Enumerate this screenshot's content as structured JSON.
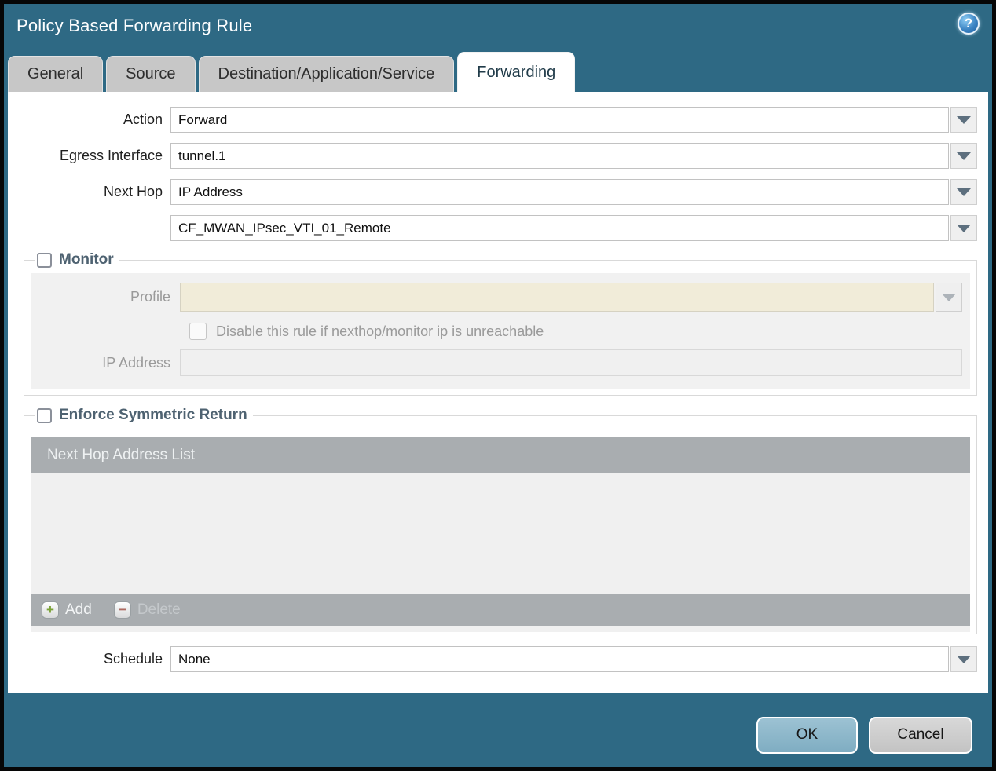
{
  "dialog": {
    "title": "Policy Based Forwarding Rule",
    "help_icon_glyph": "?"
  },
  "tabs": [
    {
      "label": "General",
      "active": false
    },
    {
      "label": "Source",
      "active": false
    },
    {
      "label": "Destination/Application/Service",
      "active": false
    },
    {
      "label": "Forwarding",
      "active": true
    }
  ],
  "form": {
    "action": {
      "label": "Action",
      "value": "Forward"
    },
    "egress_interface": {
      "label": "Egress Interface",
      "value": "tunnel.1"
    },
    "next_hop": {
      "label": "Next Hop",
      "value": "IP Address"
    },
    "next_hop_address": {
      "value": "CF_MWAN_IPsec_VTI_01_Remote"
    },
    "schedule": {
      "label": "Schedule",
      "value": "None"
    }
  },
  "monitor": {
    "legend": "Monitor",
    "checked": false,
    "profile": {
      "label": "Profile",
      "value": ""
    },
    "disable_rule": {
      "label": "Disable this rule if nexthop/monitor ip is unreachable",
      "checked": false
    },
    "ip_address": {
      "label": "IP Address",
      "value": ""
    }
  },
  "symmetric_return": {
    "legend": "Enforce Symmetric Return",
    "checked": false,
    "table": {
      "header": "Next Hop Address List",
      "rows": []
    },
    "add_label": "Add",
    "delete_label": "Delete",
    "add_icon_glyph": "+",
    "delete_icon_glyph": "−"
  },
  "footer": {
    "ok_label": "OK",
    "cancel_label": "Cancel"
  },
  "colors": {
    "titlebar_teal": "#2e6984",
    "tab_inactive": "#c7c7c7",
    "legend_text": "#4e6271",
    "table_gray": "#a9adb0",
    "table_body_gray": "#f0f0f0",
    "profile_beige": "#f1ecd9",
    "ok_button": "#7fadc2",
    "cancel_button": "#c3c3c3",
    "add_plus_green": "#7ba238",
    "delete_minus_red": "#ad6a60"
  }
}
